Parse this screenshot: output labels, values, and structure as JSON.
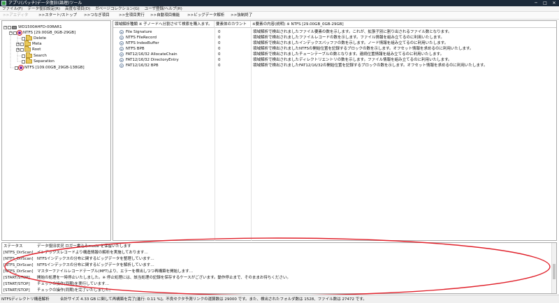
{
  "window": {
    "title": "アプリ(パッチ)データ復旧(論理)ツール",
    "minimize_glyph": "─",
    "maximize_glyph": "□",
    "close_glyph": "✕"
  },
  "menu": [
    "ファイル(F)",
    "データ復旧設定(R)",
    "高度な項目(D)",
    "ガベージコレクション(G)",
    "ユーザ登録/ヘルプ(H)"
  ],
  "toolbar": {
    "buttons": [
      {
        "label": ">>アエディタ",
        "disabled": true
      },
      {
        "label": ">>スタート/ストップ",
        "disabled": false
      },
      {
        "label": ">>つなぎ項目",
        "disabled": false
      },
      {
        "label": ">>全項目実行",
        "disabled": false
      },
      {
        "label": ">>自動項目機能",
        "disabled": false
      },
      {
        "label": ">>ビッグデータ解析",
        "disabled": false
      },
      {
        "label": ">>強制終了",
        "disabled": false
      }
    ]
  },
  "tree": {
    "root": "WD1500AHFD-00RAR1",
    "volume1": "NTFS [29.00GB_0GB-29GB]",
    "folders": [
      "Delete",
      "Meta",
      "Root",
      "Search",
      "Separation"
    ],
    "volume2": "NTFS [109.00GB_29GB-138GB]"
  },
  "grid": {
    "headers": {
      "name": "領域解析種類 ※ 子ノードへ分割させて検索を購入ます。",
      "count": "要素体のカウント",
      "desc": "※要素の内容(説明) ※ NTFS [29.00GB_0GB-29GB]"
    },
    "rows": [
      {
        "name": "File Signature",
        "count": "0",
        "desc": "領域解析で検出されましたファイル要素の数を示します。これが、拡張子別に割り出されるファイル数となります。"
      },
      {
        "name": "NTFS FileRecord",
        "count": "0",
        "desc": "領域解析で検出されましたファイルレコードの数を示します。ファイル情報を組み立てるのに利用いたします。"
      },
      {
        "name": "NTFS IndexBuffer",
        "count": "0",
        "desc": "領域解析で検出されましたインデックスバッファの数を示します。ノード情報を組み立てるのに利用いたします。"
      },
      {
        "name": "NTFS BPB",
        "count": "0",
        "desc": "領域解析で検出されましたNTFSの開始位置を記録するブロックの数を示します。オフセット情報を求めるのに利用いたします。"
      },
      {
        "name": "FAT12/16/32 AllocateChain",
        "count": "0",
        "desc": "領域解析で検出されましたチェーンテーブルの数となります。連続位置情報を組み立てるのに利用いたします。"
      },
      {
        "name": "FAT12/16/32 DirectoryEntry",
        "count": "0",
        "desc": "領域解析で検出されましたディレクトリエントリの数を示します。ファイル情報を組み立てるのに利用いたします。"
      },
      {
        "name": "FAT12/16/32 BPB",
        "count": "0",
        "desc": "領域解析で検出されましたFAT12/16/32の開始位置を記録するブロックの数を示します。オフセット情報を求めるのに利用いたします。"
      }
    ]
  },
  "log": {
    "rows": [
      {
        "src": "ステータス",
        "msg": "データ復旧状況 ロガー書込みmode を保留いたします"
      },
      {
        "src": "[NTFS_DirScan]",
        "msg": "インデックスレコードより構造情報の解析を実施しております…"
      },
      {
        "src": "[NTFS_DirScan]",
        "msg": "NTFSインデックスの分布に関するビッグデータを整理しています…"
      },
      {
        "src": "[NTFS_DirScan]",
        "msg": "NTFSインデックスの分布に関するビッグデータを解析しています…"
      },
      {
        "src": "[NTFS_DirScan]",
        "msg": "マスターファイルレコードテーブル(MFT)より、エラーを検出しつつ再構築を開始します…"
      },
      {
        "src": "[START/STOP]",
        "msg": "開始の処理を一時停止いたしました。※ 停止処理には、該当処理の記録を保存するケースがございます。動作停止まで、そのままお待ちください。"
      },
      {
        "src": "[START/STOP]",
        "msg": "チェックの操作(同期)を実行しています…"
      },
      {
        "src": "[START/STOP]",
        "msg": "チェックの操作(同期)を完了いたしました。"
      }
    ]
  },
  "status": {
    "mode": "NTFSディレクトリ構造解析",
    "summary": "合計サイズ 4.33 GB に関して再構築を完了[進行: 0.11 %]。不良セクタ予測リンクの運算数は 29000 です。また、検出されたフォルダ数は 1528、ファイル数は 27472 です。"
  },
  "colors": {
    "titlebar": "#1c2a3a",
    "annotation": "#e0202a",
    "volume_icon": "#7a1fa2",
    "folder": "#e9c85a"
  }
}
